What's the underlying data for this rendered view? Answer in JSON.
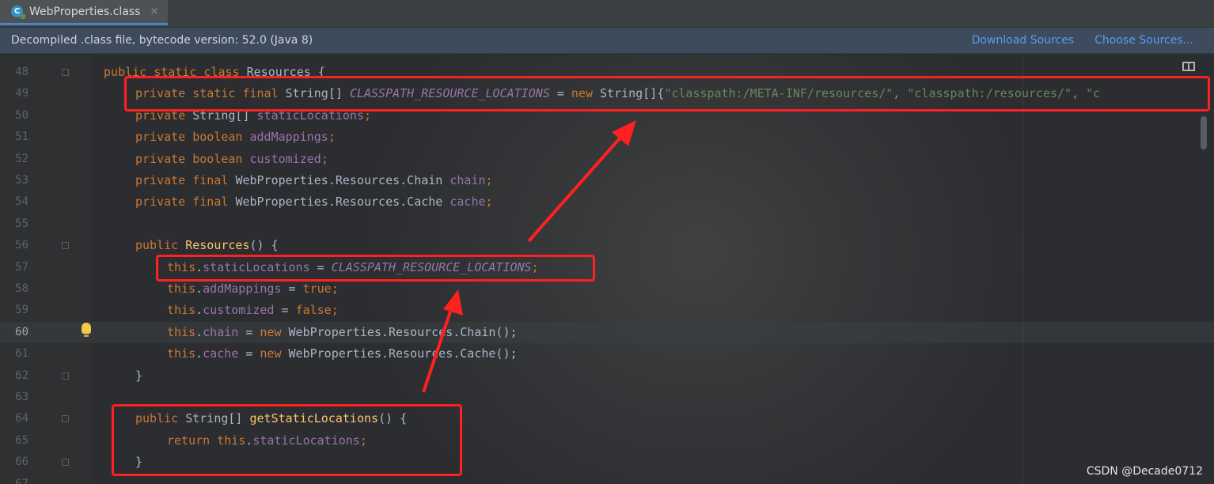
{
  "tab": {
    "title": "WebProperties.class",
    "icon": "class-file-icon",
    "close": "×",
    "icon_letter": "C"
  },
  "banner": {
    "text": "Decompiled .class file, bytecode version: 52.0 (Java 8)",
    "download_sources": "Download Sources",
    "choose_sources": "Choose Sources..."
  },
  "editor": {
    "active_line": "60",
    "lines": [
      {
        "n": "48",
        "tokens": [
          {
            "t": "public static class ",
            "c": "kw"
          },
          {
            "t": "Resources {",
            "c": ""
          }
        ]
      },
      {
        "n": "49",
        "tokens": [
          {
            "t": "private static final ",
            "c": "kw"
          },
          {
            "t": "String[] ",
            "c": ""
          },
          {
            "t": "CLASSPATH_RESOURCE_LOCATIONS",
            "c": "sf"
          },
          {
            "t": " = ",
            "c": ""
          },
          {
            "t": "new ",
            "c": "kw"
          },
          {
            "t": "String[]{",
            "c": ""
          },
          {
            "t": "\"classpath:/META-INF/resources/\"",
            "c": "str"
          },
          {
            "t": ", ",
            "c": "kw"
          },
          {
            "t": "\"classpath:/resources/\"",
            "c": "str"
          },
          {
            "t": ", ",
            "c": "kw"
          },
          {
            "t": "\"c",
            "c": "str"
          }
        ]
      },
      {
        "n": "50",
        "tokens": [
          {
            "t": "private ",
            "c": "kw"
          },
          {
            "t": "String[] ",
            "c": ""
          },
          {
            "t": "staticLocations",
            "c": "fld"
          },
          {
            "t": ";",
            "c": "kw"
          }
        ]
      },
      {
        "n": "51",
        "tokens": [
          {
            "t": "private boolean ",
            "c": "kw"
          },
          {
            "t": "addMappings",
            "c": "fld"
          },
          {
            "t": ";",
            "c": "kw"
          }
        ]
      },
      {
        "n": "52",
        "tokens": [
          {
            "t": "private boolean ",
            "c": "kw"
          },
          {
            "t": "customized",
            "c": "fld"
          },
          {
            "t": ";",
            "c": "kw"
          }
        ]
      },
      {
        "n": "53",
        "tokens": [
          {
            "t": "private final ",
            "c": "kw"
          },
          {
            "t": "WebProperties.Resources.Chain ",
            "c": ""
          },
          {
            "t": "chain",
            "c": "fld"
          },
          {
            "t": ";",
            "c": "kw"
          }
        ]
      },
      {
        "n": "54",
        "tokens": [
          {
            "t": "private final ",
            "c": "kw"
          },
          {
            "t": "WebProperties.Resources.Cache ",
            "c": ""
          },
          {
            "t": "cache",
            "c": "fld"
          },
          {
            "t": ";",
            "c": "kw"
          }
        ]
      },
      {
        "n": "55",
        "tokens": []
      },
      {
        "n": "56",
        "tokens": [
          {
            "t": "public ",
            "c": "kw"
          },
          {
            "t": "Resources",
            "c": "mt"
          },
          {
            "t": "() {",
            "c": ""
          }
        ]
      },
      {
        "n": "57",
        "tokens": [
          {
            "t": "this",
            "c": "kw"
          },
          {
            "t": ".",
            "c": ""
          },
          {
            "t": "staticLocations",
            "c": "fld"
          },
          {
            "t": " = ",
            "c": ""
          },
          {
            "t": "CLASSPATH_RESOURCE_LOCATIONS",
            "c": "sf"
          },
          {
            "t": ";",
            "c": "kw"
          }
        ]
      },
      {
        "n": "58",
        "tokens": [
          {
            "t": "this",
            "c": "kw"
          },
          {
            "t": ".",
            "c": ""
          },
          {
            "t": "addMappings",
            "c": "fld"
          },
          {
            "t": " = ",
            "c": ""
          },
          {
            "t": "true",
            "c": "kw"
          },
          {
            "t": ";",
            "c": "kw"
          }
        ]
      },
      {
        "n": "59",
        "tokens": [
          {
            "t": "this",
            "c": "kw"
          },
          {
            "t": ".",
            "c": ""
          },
          {
            "t": "customized",
            "c": "fld"
          },
          {
            "t": " = ",
            "c": ""
          },
          {
            "t": "false",
            "c": "kw"
          },
          {
            "t": ";",
            "c": "kw"
          }
        ]
      },
      {
        "n": "60",
        "tokens": [
          {
            "t": "this",
            "c": "kw"
          },
          {
            "t": ".",
            "c": ""
          },
          {
            "t": "chain",
            "c": "fld"
          },
          {
            "t": " = ",
            "c": ""
          },
          {
            "t": "new ",
            "c": "kw"
          },
          {
            "t": "WebProperties.Resources.Chain();",
            "c": ""
          }
        ]
      },
      {
        "n": "61",
        "tokens": [
          {
            "t": "this",
            "c": "kw"
          },
          {
            "t": ".",
            "c": ""
          },
          {
            "t": "cache",
            "c": "fld"
          },
          {
            "t": " = ",
            "c": ""
          },
          {
            "t": "new ",
            "c": "kw"
          },
          {
            "t": "WebProperties.Resources.Cache();",
            "c": ""
          }
        ]
      },
      {
        "n": "62",
        "tokens": [
          {
            "t": "}",
            "c": ""
          }
        ]
      },
      {
        "n": "63",
        "tokens": []
      },
      {
        "n": "64",
        "tokens": [
          {
            "t": "public ",
            "c": "kw"
          },
          {
            "t": "String[] ",
            "c": ""
          },
          {
            "t": "getStaticLocations",
            "c": "mt"
          },
          {
            "t": "() {",
            "c": ""
          }
        ]
      },
      {
        "n": "65",
        "tokens": [
          {
            "t": "return this",
            "c": "kw"
          },
          {
            "t": ".",
            "c": ""
          },
          {
            "t": "staticLocations",
            "c": "fld"
          },
          {
            "t": ";",
            "c": "kw"
          }
        ]
      },
      {
        "n": "66",
        "tokens": [
          {
            "t": "}",
            "c": ""
          }
        ]
      },
      {
        "n": "67",
        "tokens": []
      }
    ]
  },
  "watermark": "CSDN @Decade0712",
  "colors": {
    "annotation_red": "#ff2020",
    "keyword": "#cc7832",
    "field": "#9876aa",
    "string": "#6a8759",
    "method": "#ffc66d",
    "link": "#589df6"
  }
}
